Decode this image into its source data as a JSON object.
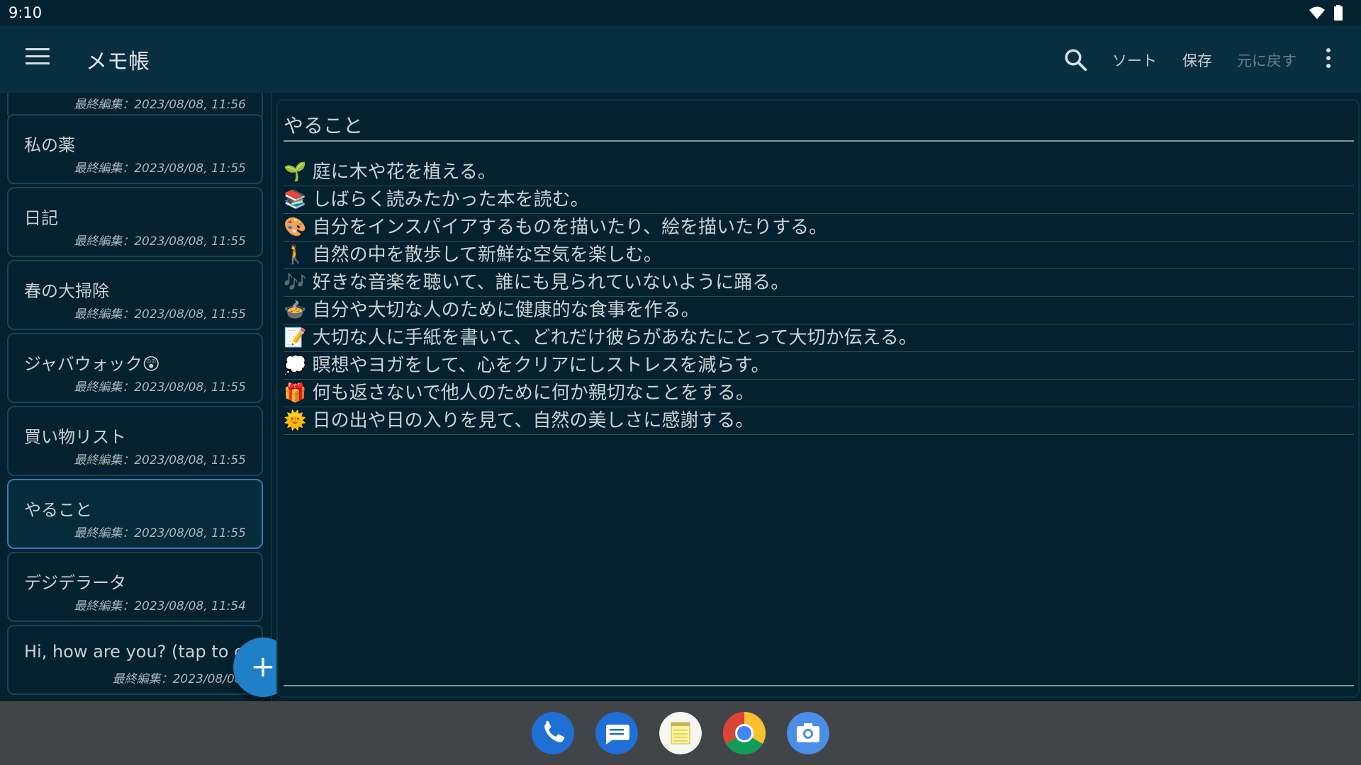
{
  "status_bar": {
    "time": "9:10"
  },
  "app_bar": {
    "title": "メモ帳",
    "sort_label": "ソート",
    "save_label": "保存",
    "undo_label": "元に戻す"
  },
  "notes": [
    {
      "title": "",
      "date": "最終編集：2023/08/08, 11:56"
    },
    {
      "title": "私の薬",
      "date": "最終編集：2023/08/08, 11:55"
    },
    {
      "title": "日記",
      "date": "最終編集：2023/08/08, 11:55"
    },
    {
      "title": "春の大掃除",
      "date": "最終編集：2023/08/08, 11:55"
    },
    {
      "title": "ジャバウォック😲",
      "date": "最終編集：2023/08/08, 11:55"
    },
    {
      "title": "買い物リスト",
      "date": "最終編集：2023/08/08, 11:55"
    },
    {
      "title": "やること",
      "date": "最終編集：2023/08/08, 11:55"
    },
    {
      "title": "デジデラータ",
      "date": "最終編集：2023/08/08, 11:54"
    },
    {
      "title": "Hi, how are you? (tap to o",
      "date": "最終編集：2023/08/08,"
    }
  ],
  "fab_label": "+",
  "editor": {
    "title": "やること",
    "lines": [
      "🌱 庭に木や花を植える。",
      "📚 しばらく読みたかった本を読む。",
      "🎨 自分をインスパイアするものを描いたり、絵を描いたりする。",
      "🚶 自然の中を散歩して新鮮な空気を楽しむ。",
      "🎶 好きな音楽を聴いて、誰にも見られていないように踊る。",
      "🍲 自分や大切な人のために健康的な食事を作る。",
      "📝 大切な人に手紙を書いて、どれだけ彼らがあなたにとって大切か伝える。",
      "💭 瞑想やヨガをして、心をクリアにしストレスを減らす。",
      "🎁 何も返さないで他人のために何か親切なことをする。",
      "🌞 日の出や日の入りを見て、自然の美しさに感謝する。"
    ]
  },
  "colors": {
    "accent": "#1f80c8",
    "background": "#03212e",
    "app_bar": "#082f40",
    "dock": "#424547"
  },
  "dock_icons": [
    "phone-icon",
    "messages-icon",
    "notepad-icon",
    "chrome-icon",
    "camera-icon"
  ]
}
